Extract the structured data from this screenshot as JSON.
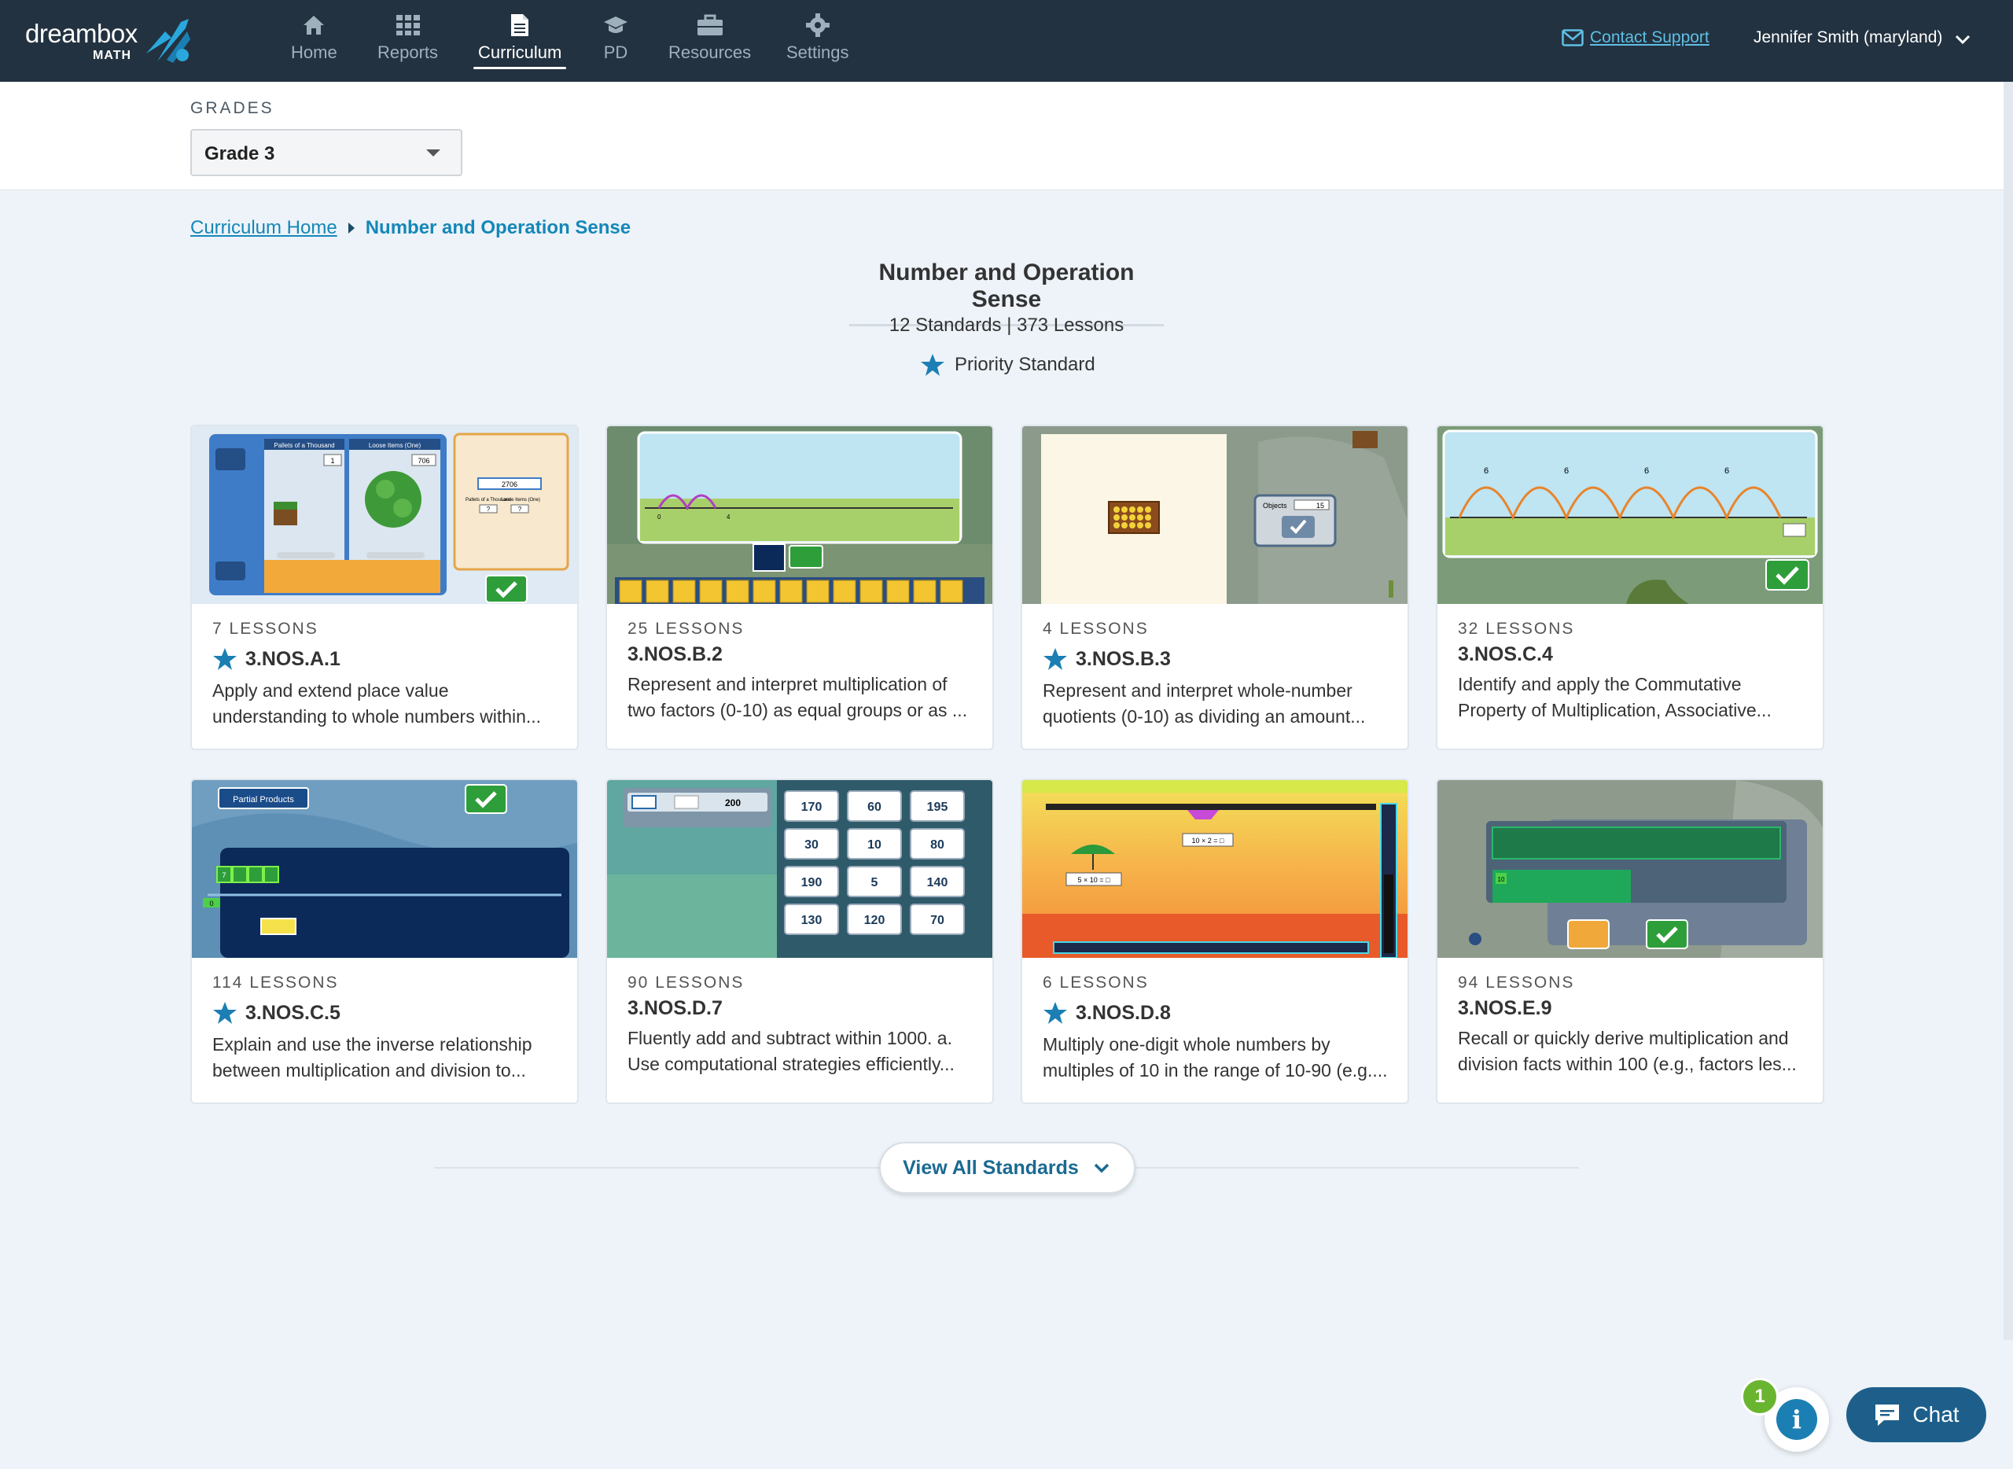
{
  "brand": {
    "name": "dreambox",
    "sub": "MATH"
  },
  "nav": [
    {
      "label": "Home",
      "icon": "home-icon"
    },
    {
      "label": "Reports",
      "icon": "grid-icon"
    },
    {
      "label": "Curriculum",
      "icon": "document-icon",
      "active": true
    },
    {
      "label": "PD",
      "icon": "graduation-cap-icon"
    },
    {
      "label": "Resources",
      "icon": "briefcase-icon"
    },
    {
      "label": "Settings",
      "icon": "gear-icon"
    }
  ],
  "header": {
    "contact_label": "Contact Support",
    "user_name": "Jennifer Smith (maryland)"
  },
  "grades": {
    "label": "GRADES",
    "selected": "Grade 3"
  },
  "breadcrumb": {
    "home": "Curriculum Home",
    "current": "Number and Operation Sense"
  },
  "page": {
    "title": "Number and Operation Sense",
    "summary": "12 Standards | 373 Lessons",
    "priority_label": "Priority Standard"
  },
  "cards": [
    {
      "lessons": "7 LESSONS",
      "code": "3.NOS.A.1",
      "priority": true,
      "desc": "Apply and extend place value understanding to whole numbers within..."
    },
    {
      "lessons": "25 LESSONS",
      "code": "3.NOS.B.2",
      "priority": false,
      "desc": "Represent and interpret multiplication of two factors (0-10) as equal groups or as ..."
    },
    {
      "lessons": "4 LESSONS",
      "code": "3.NOS.B.3",
      "priority": true,
      "desc": "Represent and interpret whole-number quotients (0-10) as dividing an amount..."
    },
    {
      "lessons": "32 LESSONS",
      "code": "3.NOS.C.4",
      "priority": false,
      "desc": "Identify and apply the Commutative Property of Multiplication, Associative..."
    },
    {
      "lessons": "114 LESSONS",
      "code": "3.NOS.C.5",
      "priority": true,
      "desc": "Explain and use the inverse relationship between multiplication and division to..."
    },
    {
      "lessons": "90 LESSONS",
      "code": "3.NOS.D.7",
      "priority": false,
      "desc": "Fluently add and subtract within 1000. a. Use computational strategies efficiently..."
    },
    {
      "lessons": "6 LESSONS",
      "code": "3.NOS.D.8",
      "priority": true,
      "desc": "Multiply one-digit whole numbers by multiples of 10 in the range of 10-90 (e.g...."
    },
    {
      "lessons": "94 LESSONS",
      "code": "3.NOS.E.9",
      "priority": false,
      "desc": "Recall or quickly derive multiplication and division facts within 100 (e.g., factors les..."
    }
  ],
  "thumb_text": {
    "c1": {
      "left_head": "Pallets of a Thousand",
      "mid_head": "Loose Items (One)",
      "left_val": "1",
      "mid_val": "706",
      "panel_val": "2706",
      "panel_a": "Pallets of a Thousand",
      "panel_b": "Loose Items (One)",
      "q1": "?",
      "q2": "?"
    },
    "c2": {
      "n0": "0",
      "n4": "4"
    },
    "c3": {
      "label": "Objects",
      "val": "15"
    },
    "c4": {
      "j1": "6",
      "j2": "6",
      "j3": "6",
      "j4": "6"
    },
    "c5": {
      "label": "Partial Products",
      "g": "7",
      "z": "0"
    },
    "c6": {
      "eq": "200",
      "cells": [
        "170",
        "60",
        "195",
        "30",
        "10",
        "80",
        "190",
        "5",
        "140",
        "130",
        "120",
        "70"
      ]
    },
    "c7": {
      "a": "10 × 2 = □",
      "b": "5 × 10 = □"
    },
    "c8": {
      "tag": "10"
    }
  },
  "footer": {
    "view_all": "View All Standards",
    "badge": "1",
    "info": "i",
    "chat": "Chat"
  },
  "colors": {
    "nav_bg": "#233240",
    "link": "#1587b8",
    "star": "#1b7fb3",
    "check_green": "#2e9e3a",
    "chat_bg": "#1d5f8a"
  }
}
